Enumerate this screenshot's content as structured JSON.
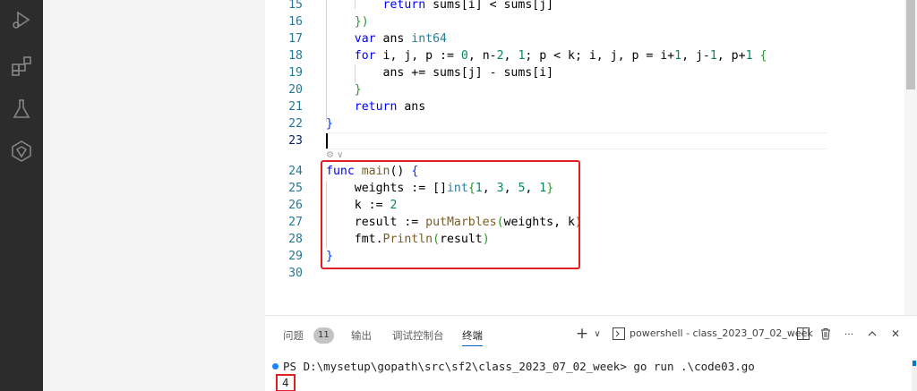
{
  "editor": {
    "lines": [
      {
        "num": "15",
        "tokens": [
          {
            "t": "        ",
            "c": "tx"
          },
          {
            "t": "return",
            "c": "kw"
          },
          {
            "t": " sums[i] < sums[j]",
            "c": "tx"
          }
        ]
      },
      {
        "num": "16",
        "tokens": [
          {
            "t": "    ",
            "c": "tx"
          },
          {
            "t": "})",
            "c": "br2"
          }
        ]
      },
      {
        "num": "17",
        "tokens": [
          {
            "t": "    ",
            "c": "tx"
          },
          {
            "t": "var",
            "c": "kw"
          },
          {
            "t": " ans ",
            "c": "tx"
          },
          {
            "t": "int64",
            "c": "ty"
          }
        ]
      },
      {
        "num": "18",
        "tokens": [
          {
            "t": "    ",
            "c": "tx"
          },
          {
            "t": "for",
            "c": "kw"
          },
          {
            "t": " i, j, p := ",
            "c": "tx"
          },
          {
            "t": "0",
            "c": "nm"
          },
          {
            "t": ", n-",
            "c": "tx"
          },
          {
            "t": "2",
            "c": "nm"
          },
          {
            "t": ", ",
            "c": "tx"
          },
          {
            "t": "1",
            "c": "nm"
          },
          {
            "t": "; p < k; i, j, p = i+",
            "c": "tx"
          },
          {
            "t": "1",
            "c": "nm"
          },
          {
            "t": ", j-",
            "c": "tx"
          },
          {
            "t": "1",
            "c": "nm"
          },
          {
            "t": ", p+",
            "c": "tx"
          },
          {
            "t": "1",
            "c": "nm"
          },
          {
            "t": " ",
            "c": "tx"
          },
          {
            "t": "{",
            "c": "br2"
          }
        ]
      },
      {
        "num": "19",
        "tokens": [
          {
            "t": "        ans += sums[j] - sums[i]",
            "c": "tx"
          }
        ]
      },
      {
        "num": "20",
        "tokens": [
          {
            "t": "    ",
            "c": "tx"
          },
          {
            "t": "}",
            "c": "br2"
          }
        ]
      },
      {
        "num": "21",
        "tokens": [
          {
            "t": "    ",
            "c": "tx"
          },
          {
            "t": "return",
            "c": "kw"
          },
          {
            "t": " ans",
            "c": "tx"
          }
        ]
      },
      {
        "num": "22",
        "tokens": [
          {
            "t": "}",
            "c": "br1"
          }
        ]
      },
      {
        "num": "23",
        "tokens": []
      },
      {
        "num": "24",
        "tokens": [
          {
            "t": "func",
            "c": "kw"
          },
          {
            "t": " ",
            "c": "tx"
          },
          {
            "t": "main",
            "c": "fn"
          },
          {
            "t": "() ",
            "c": "tx"
          },
          {
            "t": "{",
            "c": "br1"
          }
        ]
      },
      {
        "num": "25",
        "tokens": [
          {
            "t": "    weights := []",
            "c": "tx"
          },
          {
            "t": "int",
            "c": "ty"
          },
          {
            "t": "{",
            "c": "br2"
          },
          {
            "t": "1",
            "c": "nm"
          },
          {
            "t": ", ",
            "c": "tx"
          },
          {
            "t": "3",
            "c": "nm"
          },
          {
            "t": ", ",
            "c": "tx"
          },
          {
            "t": "5",
            "c": "nm"
          },
          {
            "t": ", ",
            "c": "tx"
          },
          {
            "t": "1",
            "c": "nm"
          },
          {
            "t": "}",
            "c": "br2"
          }
        ]
      },
      {
        "num": "26",
        "tokens": [
          {
            "t": "    k := ",
            "c": "tx"
          },
          {
            "t": "2",
            "c": "nm"
          }
        ]
      },
      {
        "num": "27",
        "tokens": [
          {
            "t": "    result := ",
            "c": "tx"
          },
          {
            "t": "putMarbles",
            "c": "fn"
          },
          {
            "t": "(",
            "c": "br2"
          },
          {
            "t": "weights, k",
            "c": "tx"
          },
          {
            "t": ")",
            "c": "br2"
          }
        ]
      },
      {
        "num": "28",
        "tokens": [
          {
            "t": "    fmt.",
            "c": "tx"
          },
          {
            "t": "Println",
            "c": "fn"
          },
          {
            "t": "(",
            "c": "br2"
          },
          {
            "t": "result",
            "c": "tx"
          },
          {
            "t": ")",
            "c": "br2"
          }
        ]
      },
      {
        "num": "29",
        "tokens": [
          {
            "t": "}",
            "c": "br1"
          }
        ]
      },
      {
        "num": "30",
        "tokens": []
      }
    ],
    "active_line": "23"
  },
  "panel": {
    "tabs": {
      "problems": "问题",
      "problems_count": "11",
      "output": "输出",
      "debug_console": "调试控制台",
      "terminal": "终端"
    },
    "terminal_name": "powershell - class_2023_07_02_week",
    "add_symbol": "+",
    "dropdown_symbol": "∨",
    "more_symbol": "···",
    "close_symbol": "✕",
    "prompt": "PS D:\\mysetup\\gopath\\src\\sf2\\class_2023_07_02_week> go run .\\code03.go",
    "output": "4"
  }
}
